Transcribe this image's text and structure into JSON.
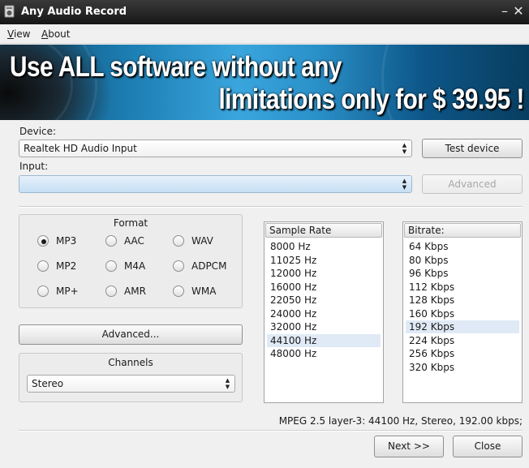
{
  "window": {
    "title": "Any Audio Record",
    "minimize_icon": "minimize-icon",
    "close_icon": "close-icon"
  },
  "menu": {
    "view": "iew",
    "view_mnemonic": "V",
    "about": "bout",
    "about_mnemonic": "A"
  },
  "banner": {
    "line1": "Use ALL software without any",
    "line2": "limitations only for $ 39.95 !"
  },
  "device": {
    "label": "Device:",
    "value": "Realtek HD Audio Input",
    "test_button": "Test device"
  },
  "input": {
    "label": "Input:",
    "value": "",
    "advanced_button": "Advanced"
  },
  "format": {
    "title": "Format",
    "selected": "MP3",
    "options": [
      "MP3",
      "AAC",
      "WAV",
      "MP2",
      "M4A",
      "ADPCM",
      "MP+",
      "AMR",
      "WMA"
    ]
  },
  "advanced_button": "Advanced...",
  "channels": {
    "title": "Channels",
    "value": "Stereo"
  },
  "sample_rate": {
    "header": "Sample Rate",
    "items": [
      "8000 Hz",
      "11025 Hz",
      "12000 Hz",
      "16000 Hz",
      "22050 Hz",
      "24000 Hz",
      "32000 Hz",
      "44100 Hz",
      "48000 Hz"
    ],
    "selected_index": 7
  },
  "bitrate": {
    "header": "Bitrate:",
    "items": [
      "64 Kbps",
      "80 Kbps",
      "96 Kbps",
      "112 Kbps",
      "128 Kbps",
      "160 Kbps",
      "192 Kbps",
      "224 Kbps",
      "256 Kbps",
      "320 Kbps"
    ],
    "selected_index": 6
  },
  "status": "MPEG 2.5 layer-3: 44100 Hz,  Stereo, 192.00 kbps;",
  "buttons": {
    "next": "Next >>",
    "close": "Close"
  },
  "colors": {
    "titlebar": "#161616",
    "banner_accent": "#3aa5dd",
    "selection": "#e0eaf6"
  }
}
